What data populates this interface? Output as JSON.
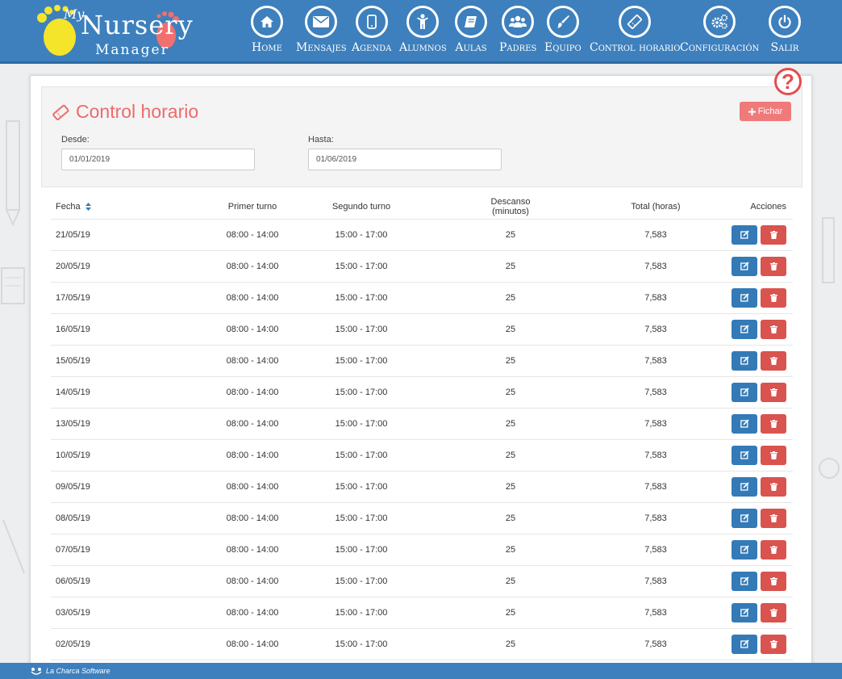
{
  "logo": {
    "my": "My",
    "nursery": "Nursery",
    "manager": "Manager"
  },
  "nav": [
    {
      "label": "Home",
      "icon": "home-icon"
    },
    {
      "label": "Mensajes",
      "icon": "envelope-icon"
    },
    {
      "label": "Agenda",
      "icon": "phone-icon"
    },
    {
      "label": "Alumnos",
      "icon": "child-icon"
    },
    {
      "label": "Aulas",
      "icon": "book-icon"
    },
    {
      "label": "Padres",
      "icon": "users-icon"
    },
    {
      "label": "Equipo",
      "icon": "brush-icon"
    },
    {
      "label": "Control horario",
      "icon": "ticket-icon"
    },
    {
      "label": "Configuración",
      "icon": "gears-icon"
    },
    {
      "label": "Salir",
      "icon": "power-icon"
    }
  ],
  "help": {
    "label": "?"
  },
  "page": {
    "title": "Control horario",
    "fichar_label": "Fichar"
  },
  "filters": {
    "desde_label": "Desde:",
    "desde_value": "01/01/2019",
    "hasta_label": "Hasta:",
    "hasta_value": "01/06/2019"
  },
  "table": {
    "headers": {
      "fecha": "Fecha",
      "primer": "Primer turno",
      "segundo": "Segundo turno",
      "descanso": "Descanso (minutos)",
      "total": "Total (horas)",
      "acciones": "Acciones"
    },
    "rows": [
      {
        "fecha": "21/05/19",
        "primer": "08:00 - 14:00",
        "segundo": "15:00 - 17:00",
        "descanso": "25",
        "total": "7,583"
      },
      {
        "fecha": "20/05/19",
        "primer": "08:00 - 14:00",
        "segundo": "15:00 - 17:00",
        "descanso": "25",
        "total": "7,583"
      },
      {
        "fecha": "17/05/19",
        "primer": "08:00 - 14:00",
        "segundo": "15:00 - 17:00",
        "descanso": "25",
        "total": "7,583"
      },
      {
        "fecha": "16/05/19",
        "primer": "08:00 - 14:00",
        "segundo": "15:00 - 17:00",
        "descanso": "25",
        "total": "7,583"
      },
      {
        "fecha": "15/05/19",
        "primer": "08:00 - 14:00",
        "segundo": "15:00 - 17:00",
        "descanso": "25",
        "total": "7,583"
      },
      {
        "fecha": "14/05/19",
        "primer": "08:00 - 14:00",
        "segundo": "15:00 - 17:00",
        "descanso": "25",
        "total": "7,583"
      },
      {
        "fecha": "13/05/19",
        "primer": "08:00 - 14:00",
        "segundo": "15:00 - 17:00",
        "descanso": "25",
        "total": "7,583"
      },
      {
        "fecha": "10/05/19",
        "primer": "08:00 - 14:00",
        "segundo": "15:00 - 17:00",
        "descanso": "25",
        "total": "7,583"
      },
      {
        "fecha": "09/05/19",
        "primer": "08:00 - 14:00",
        "segundo": "15:00 - 17:00",
        "descanso": "25",
        "total": "7,583"
      },
      {
        "fecha": "08/05/19",
        "primer": "08:00 - 14:00",
        "segundo": "15:00 - 17:00",
        "descanso": "25",
        "total": "7,583"
      },
      {
        "fecha": "07/05/19",
        "primer": "08:00 - 14:00",
        "segundo": "15:00 - 17:00",
        "descanso": "25",
        "total": "7,583"
      },
      {
        "fecha": "06/05/19",
        "primer": "08:00 - 14:00",
        "segundo": "15:00 - 17:00",
        "descanso": "25",
        "total": "7,583"
      },
      {
        "fecha": "03/05/19",
        "primer": "08:00 - 14:00",
        "segundo": "15:00 - 17:00",
        "descanso": "25",
        "total": "7,583"
      },
      {
        "fecha": "02/05/19",
        "primer": "08:00 - 14:00",
        "segundo": "15:00 - 17:00",
        "descanso": "25",
        "total": "7,583"
      }
    ],
    "row_actions": {
      "edit_icon": "edit-icon",
      "delete_icon": "trash-icon"
    }
  },
  "footer": {
    "brand": "La Charca Software"
  },
  "colors": {
    "primary": "#3d80bd",
    "accent": "#ef6a6a",
    "edit": "#337ab7",
    "delete": "#d9534f"
  }
}
